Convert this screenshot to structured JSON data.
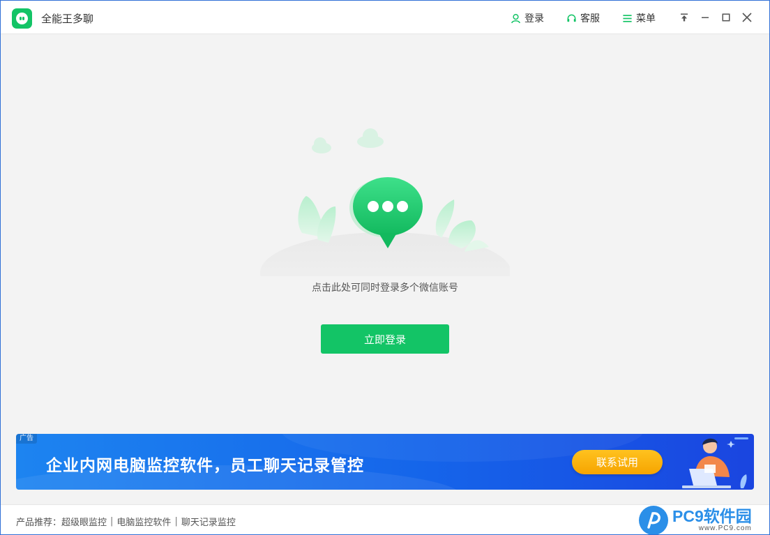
{
  "window": {
    "title": "全能王多聊"
  },
  "toolbar": {
    "login_label": "登录",
    "service_label": "客服",
    "menu_label": "菜单"
  },
  "main": {
    "tip": "点击此处可同时登录多个微信账号",
    "login_button": "立即登录"
  },
  "banner": {
    "ad_tag": "广告",
    "headline": "企业内网电脑监控软件，员工聊天记录管控",
    "cta": "联系试用"
  },
  "footer": {
    "prefix": "产品推荐：",
    "links": [
      "超级眼监控",
      "电脑监控软件",
      "聊天记录监控"
    ],
    "separator": "|"
  },
  "watermark": {
    "name": "PC9软件园",
    "url": "www.PC9.com"
  },
  "colors": {
    "accent": "#13c466",
    "banner_blue": "#1565ea",
    "cta_orange": "#f6a400",
    "watermark_blue": "#2b8fe8"
  },
  "icons": {
    "app_logo": "chat-face-icon",
    "login": "user-icon",
    "service": "headset-icon",
    "menu": "hamburger-icon",
    "pin": "pin-top-icon",
    "minimize": "minimize-icon",
    "maximize": "maximize-icon",
    "close": "close-icon"
  }
}
